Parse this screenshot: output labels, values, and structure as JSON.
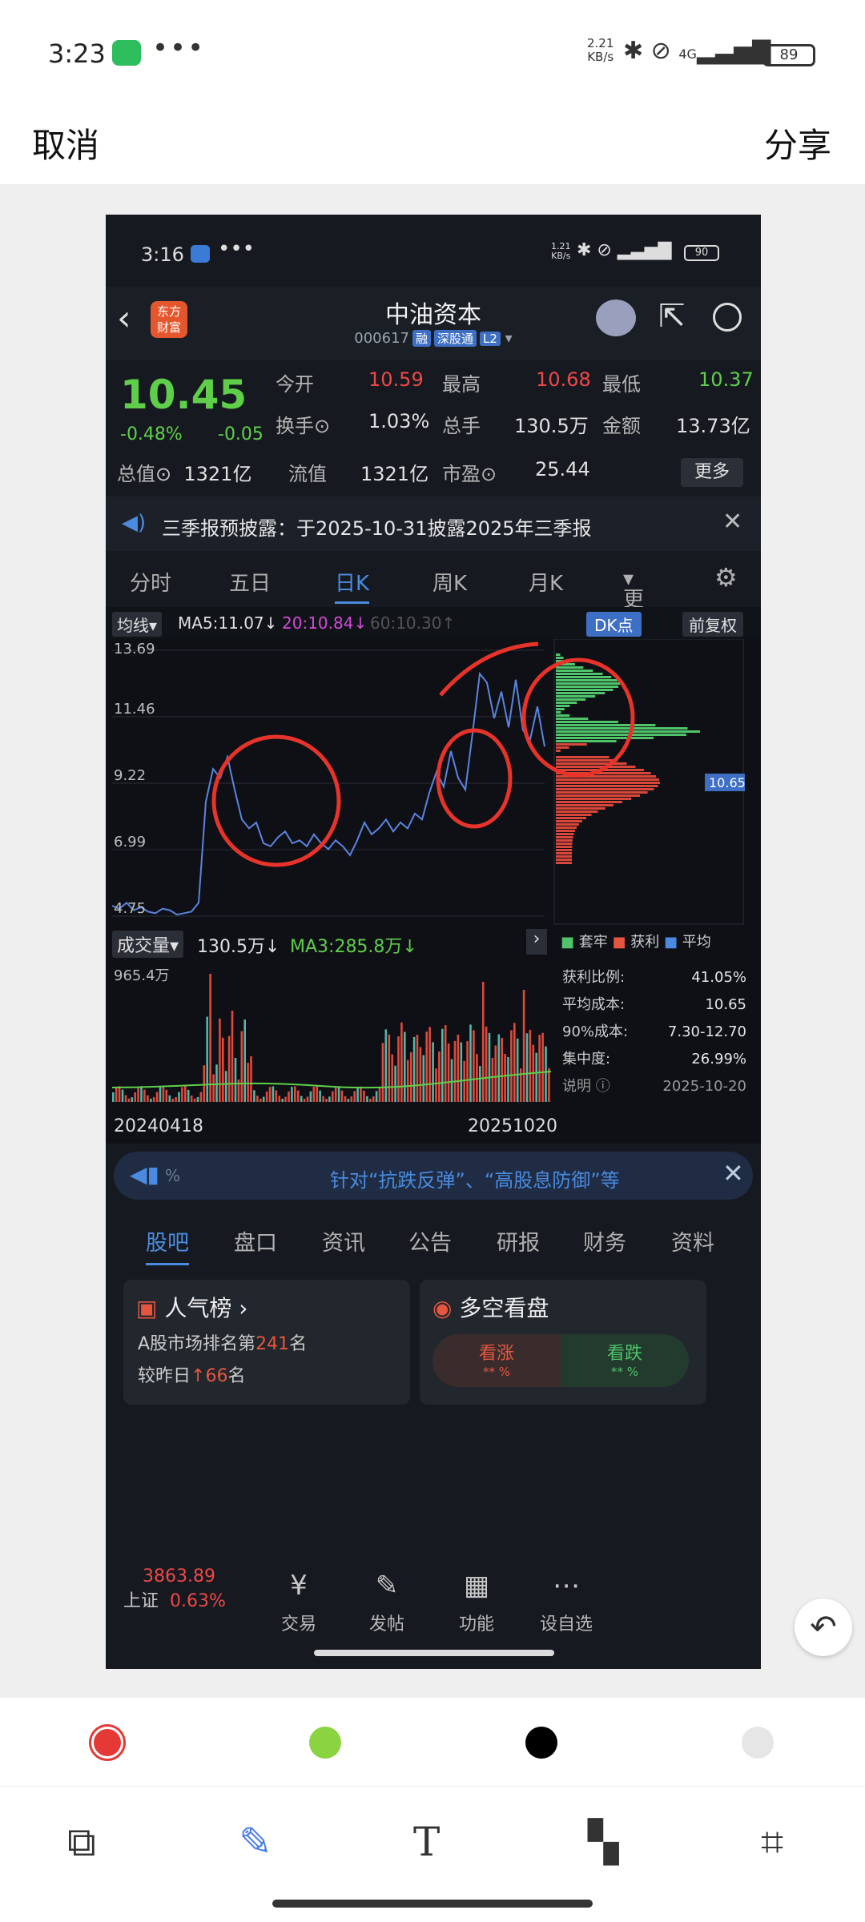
{
  "status": {
    "time": "3:23",
    "rate": "2.21\nKB/s",
    "network": "4G",
    "battery": "89"
  },
  "top_bar": {
    "cancel": "取消",
    "share": "分享"
  },
  "inner_status": {
    "time": "3:16",
    "rate": "1.21\nKB/s",
    "network": "4G",
    "battery": "90"
  },
  "stock": {
    "name": "中油资本",
    "code": "000617",
    "tags": [
      "融",
      "深股通",
      "L2"
    ],
    "price": "10.45",
    "change_pct": "-0.48%",
    "change": "-0.05",
    "market_cap_label": "总值",
    "market_cap": "1321亿",
    "fields": [
      {
        "label": "今开",
        "value": "10.59",
        "color": "red"
      },
      {
        "label": "最高",
        "value": "10.68",
        "color": "red"
      },
      {
        "label": "最低",
        "value": "10.37",
        "color": "green"
      },
      {
        "label": "换手",
        "value": "1.03%",
        "color": "white"
      },
      {
        "label": "总手",
        "value": "130.5万",
        "color": "white"
      },
      {
        "label": "金额",
        "value": "13.73亿",
        "color": "white"
      },
      {
        "label": "流值",
        "value": "1321亿",
        "color": "white"
      },
      {
        "label": "市盈",
        "value": "25.44",
        "color": "white"
      }
    ],
    "more": "更多"
  },
  "notice": {
    "text": "三季报预披露：于2025-10-31披露2025年三季报"
  },
  "kline_tabs": [
    "分时",
    "五日",
    "日K",
    "周K",
    "月K",
    "更多"
  ],
  "chart_header": {
    "ma_select": "均线",
    "ma5": "MA5:11.07",
    "ma20": "20:10.84",
    "ma60": "60:10.30",
    "dk": "DK点",
    "fq": "前复权"
  },
  "chart_data": {
    "type": "line",
    "yticks": [
      "13.69",
      "11.46",
      "9.22",
      "6.99",
      "4.75"
    ],
    "ylim": [
      4.75,
      13.69
    ],
    "x_start": "20240418",
    "x_end": "20251020",
    "series": [
      {
        "values": [
          5.1,
          5.0,
          5.2,
          4.95,
          5.05,
          4.9,
          4.85,
          5.0,
          4.95,
          4.8,
          4.85,
          4.9,
          5.2,
          8.6,
          9.7,
          9.4,
          10.1,
          9.0,
          8.0,
          7.7,
          7.9,
          7.2,
          7.1,
          7.4,
          7.6,
          7.2,
          7.3,
          7.1,
          7.5,
          7.2,
          7.0,
          7.3,
          7.1,
          6.8,
          7.3,
          7.9,
          7.5,
          7.7,
          8.0,
          7.6,
          7.9,
          7.7,
          8.2,
          8.0,
          8.9,
          9.6,
          9.1,
          10.3,
          9.4,
          9.0,
          10.9,
          12.9,
          12.6,
          11.4,
          12.3,
          11.1,
          12.7,
          11.0,
          10.7,
          11.8,
          10.45
        ]
      }
    ],
    "chip_current": "10.65",
    "volume": {
      "label": "成交量",
      "value": "130.5万",
      "ma3": "MA3:285.8万",
      "max_label": "965.4万"
    },
    "chip_legend": [
      "套牢",
      "获利",
      "平均"
    ],
    "chip_stats": [
      {
        "label": "获利比例:",
        "value": "41.05%"
      },
      {
        "label": "平均成本:",
        "value": "10.65"
      },
      {
        "label": "90%成本:",
        "value": "7.30-12.70"
      },
      {
        "label": "集中度:",
        "value": "26.99%"
      }
    ],
    "chip_note": "说明",
    "chip_date": "2025-10-20"
  },
  "marquee": {
    "text": "针对“抗跌反弹”、“高股息防御”等"
  },
  "bottom_tabs": [
    "股吧",
    "盘口",
    "资讯",
    "公告",
    "研报",
    "财务",
    "资料"
  ],
  "popularity": {
    "title": "人气榜",
    "line1_prefix": "A股市场排名第",
    "rank": "241",
    "line1_suffix": "名",
    "line2_prefix": "较昨日",
    "delta": "66",
    "line2_suffix": "名"
  },
  "sentiment": {
    "title": "多空看盘",
    "up": "看涨",
    "down": "看跌",
    "up_pct": "** %",
    "down_pct": "** %"
  },
  "nav": {
    "index_value": "3863.89",
    "index_name": "上证",
    "index_pct": "0.63%",
    "items": [
      "交易",
      "发帖",
      "功能",
      "设自选"
    ]
  },
  "palette": {
    "colors": [
      "#e53935",
      "#8bd340",
      "#000000",
      "#e6e6e6"
    ]
  }
}
